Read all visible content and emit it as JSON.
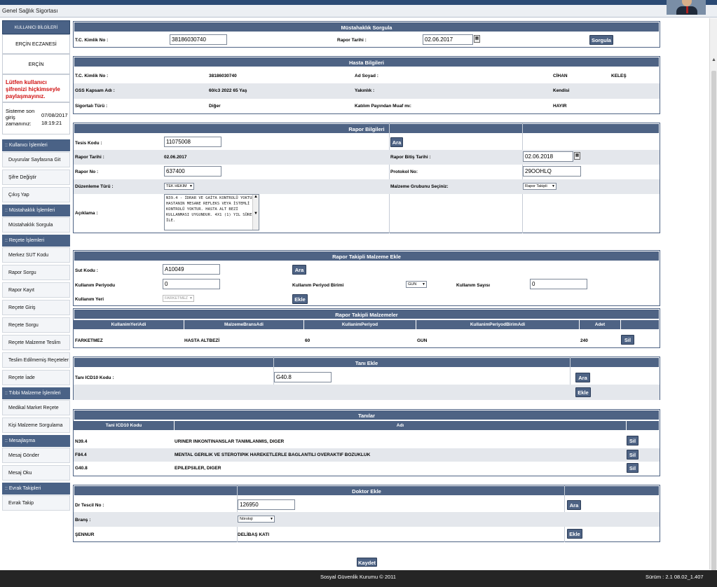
{
  "app": {
    "title": "Genel Sağlık Sigortası",
    "collapse_icon": "chevron-up-icon"
  },
  "sidebar": {
    "user_header": "KULLANICI BİLGİLERİ",
    "pharmacy": "ERÇİN ECZANESİ",
    "user": "ERÇİN",
    "warning": "Lütfen kullanıcı şifrenizi hiçkimseyle paylaşmayınız.",
    "last_login_label": "Sisteme son giriş zamanınız:",
    "last_login_date": "07/08/2017",
    "last_login_time": "18:19:21",
    "sections": [
      {
        "title": ":: Kullanıcı İşlemleri",
        "items": [
          "Duyurular Sayfasına Git",
          "Şifre Değiştir",
          "Çıkış Yap"
        ]
      },
      {
        "title": ":: Müstahaklık İşlemleri",
        "items": [
          "Müstahaklık Sorgula"
        ]
      },
      {
        "title": ":: Reçete İşlemleri",
        "items": [
          "Merkez SUT Kodu Tanımlama",
          "Rapor Sorgu",
          "Rapor Kayıt",
          "Reçete Giriş",
          "Reçete Sorgu",
          "Reçete Malzeme Teslim",
          "Teslim Edilmemiş Reçeteler",
          "Reçete İade"
        ]
      },
      {
        "title": ":: Tıbbi Malzeme İşlemleri",
        "items": [
          "Medikal Market Reçete Sorgu",
          "Kişi Malzeme Sorgulama"
        ]
      },
      {
        "title": ":: Mesajlaşma",
        "items": [
          "Mesaj Gönder",
          "Mesaj Oku"
        ]
      },
      {
        "title": ":: Evrak Takipleri",
        "items": [
          "Evrak Takip"
        ]
      }
    ]
  },
  "mustahaklik": {
    "title": "Müstahaklık Sorgula",
    "tc_label": "T.C. Kimlik No :",
    "tc_value": "38186030740",
    "date_label": "Rapor Tarihi :",
    "date_value": "02.06.2017",
    "button": "Sorgula"
  },
  "hasta": {
    "title": "Hasta Bilgileri",
    "tc_label": "T.C. Kimlik No :",
    "tc_value": "38186030740",
    "name_label": "Ad Soyad :",
    "first_name": "CİHAN",
    "last_name": "KELEŞ",
    "gss_label": "GSS Kapsam Adı :",
    "gss_value": "60/c3 2022 65 Yaş",
    "yakinlik_label": "Yakınlık :",
    "yakinlik_value": "Kendisi",
    "sigorta_label": "Sigortalı Türü :",
    "sigorta_value": "Diğer",
    "katilim_label": "Katılım Payından Muaf mı:",
    "katilim_value": "HAYIR"
  },
  "rapor": {
    "title": "Rapor Bilgileri",
    "tesis_label": "Tesis Kodu :",
    "tesis_value": "11075008",
    "ara": "Ara",
    "tarih_label": "Rapor Tarihi :",
    "tarih_value": "02.06.2017",
    "bitis_label": "Rapor Bitiş Tarihi :",
    "bitis_value": "02.06.2018",
    "no_label": "Rapor No :",
    "no_value": "637400",
    "protokol_label": "Protokol No:",
    "protokol_value": "29OOHLQ",
    "duzen_label": "Düzenleme Türü :",
    "duzen_value": "TEK HEKIM",
    "malzeme_grup_label": "Malzeme Grubunu Seçiniz:",
    "malzeme_grup_value": "Rapor Takipli",
    "aciklama_label": "Açıklama :",
    "aciklama_value": "N39.4 - İDRAR VE GAİTA KONTROLÜ YOKTUR. HASTANIN MESANE REFLEKS VEYA İSTEMLİ KONTROLÜ YOKTUR. HASTA ALT BEZİ KULLANMASI UYGUNDUR. 4X1 (1) YIL SÜRE İLE."
  },
  "malzeme_ekle": {
    "title": "Rapor Takipli Malzeme Ekle",
    "sut_label": "Sut Kodu :",
    "sut_value": "A10049",
    "ara": "Ara",
    "periyod_label": "Kullanım Periyodu",
    "periyod_value": "0",
    "birim_label": "Kullanım Periyod Birimi",
    "birim_value": "GUN",
    "sayi_label": "Kullanım Sayısı",
    "sayi_value": "0",
    "yer_label": "Kullanım Yeri",
    "yer_value": "FARKETMEZ",
    "ekle": "Ekle"
  },
  "malzemeler": {
    "title": "Rapor Takipli Malzemeler",
    "headers": [
      "KullanimYeriAdi",
      "MalzemeBransAdi",
      "KullanimPeriyod",
      "KullanimPeriyodBirimAdi",
      "Adet"
    ],
    "rows": [
      [
        "FARKETMEZ",
        "HASTA ALTBEZİ",
        "60",
        "GUN",
        "240"
      ]
    ],
    "sil": "Sil"
  },
  "tani_ekle": {
    "title": "Tanı Ekle",
    "label": "Tanı ICD10 Kodu :",
    "value": "G40.8",
    "ara": "Ara",
    "ekle": "Ekle"
  },
  "tanilar": {
    "title": "Tanılar",
    "headers": [
      "Tani ICD10 Kodu",
      "Adı"
    ],
    "rows": [
      [
        "N39.4",
        "URINER INKONTINANSLAR TANIMLANMIS, DIGER"
      ],
      [
        "F84.4",
        "MENTAL GERILIK VE STEROTIPIK HAREKETLERLE BAGLANTILI OVERAKTIF BOZUKLUK"
      ],
      [
        "G40.8",
        "EPILEPSILER, DIGER"
      ]
    ],
    "sil": "Sil"
  },
  "doktor": {
    "title": "Doktor Ekle",
    "tescil_label": "Dr Tescil No :",
    "tescil_value": "126950",
    "ara": "Ara",
    "brans_label": "Branş :",
    "brans_value": "Nöroloji",
    "first_name": "ŞENNUR",
    "last_name": "DELİBAŞ KATI",
    "ekle": "Ekle"
  },
  "kaydet": "Kaydet",
  "footer": {
    "copyright": "Sosyal Güvenlik Kurumu © 2011",
    "version": "Sürüm : 2.1 08.02_1.407"
  }
}
